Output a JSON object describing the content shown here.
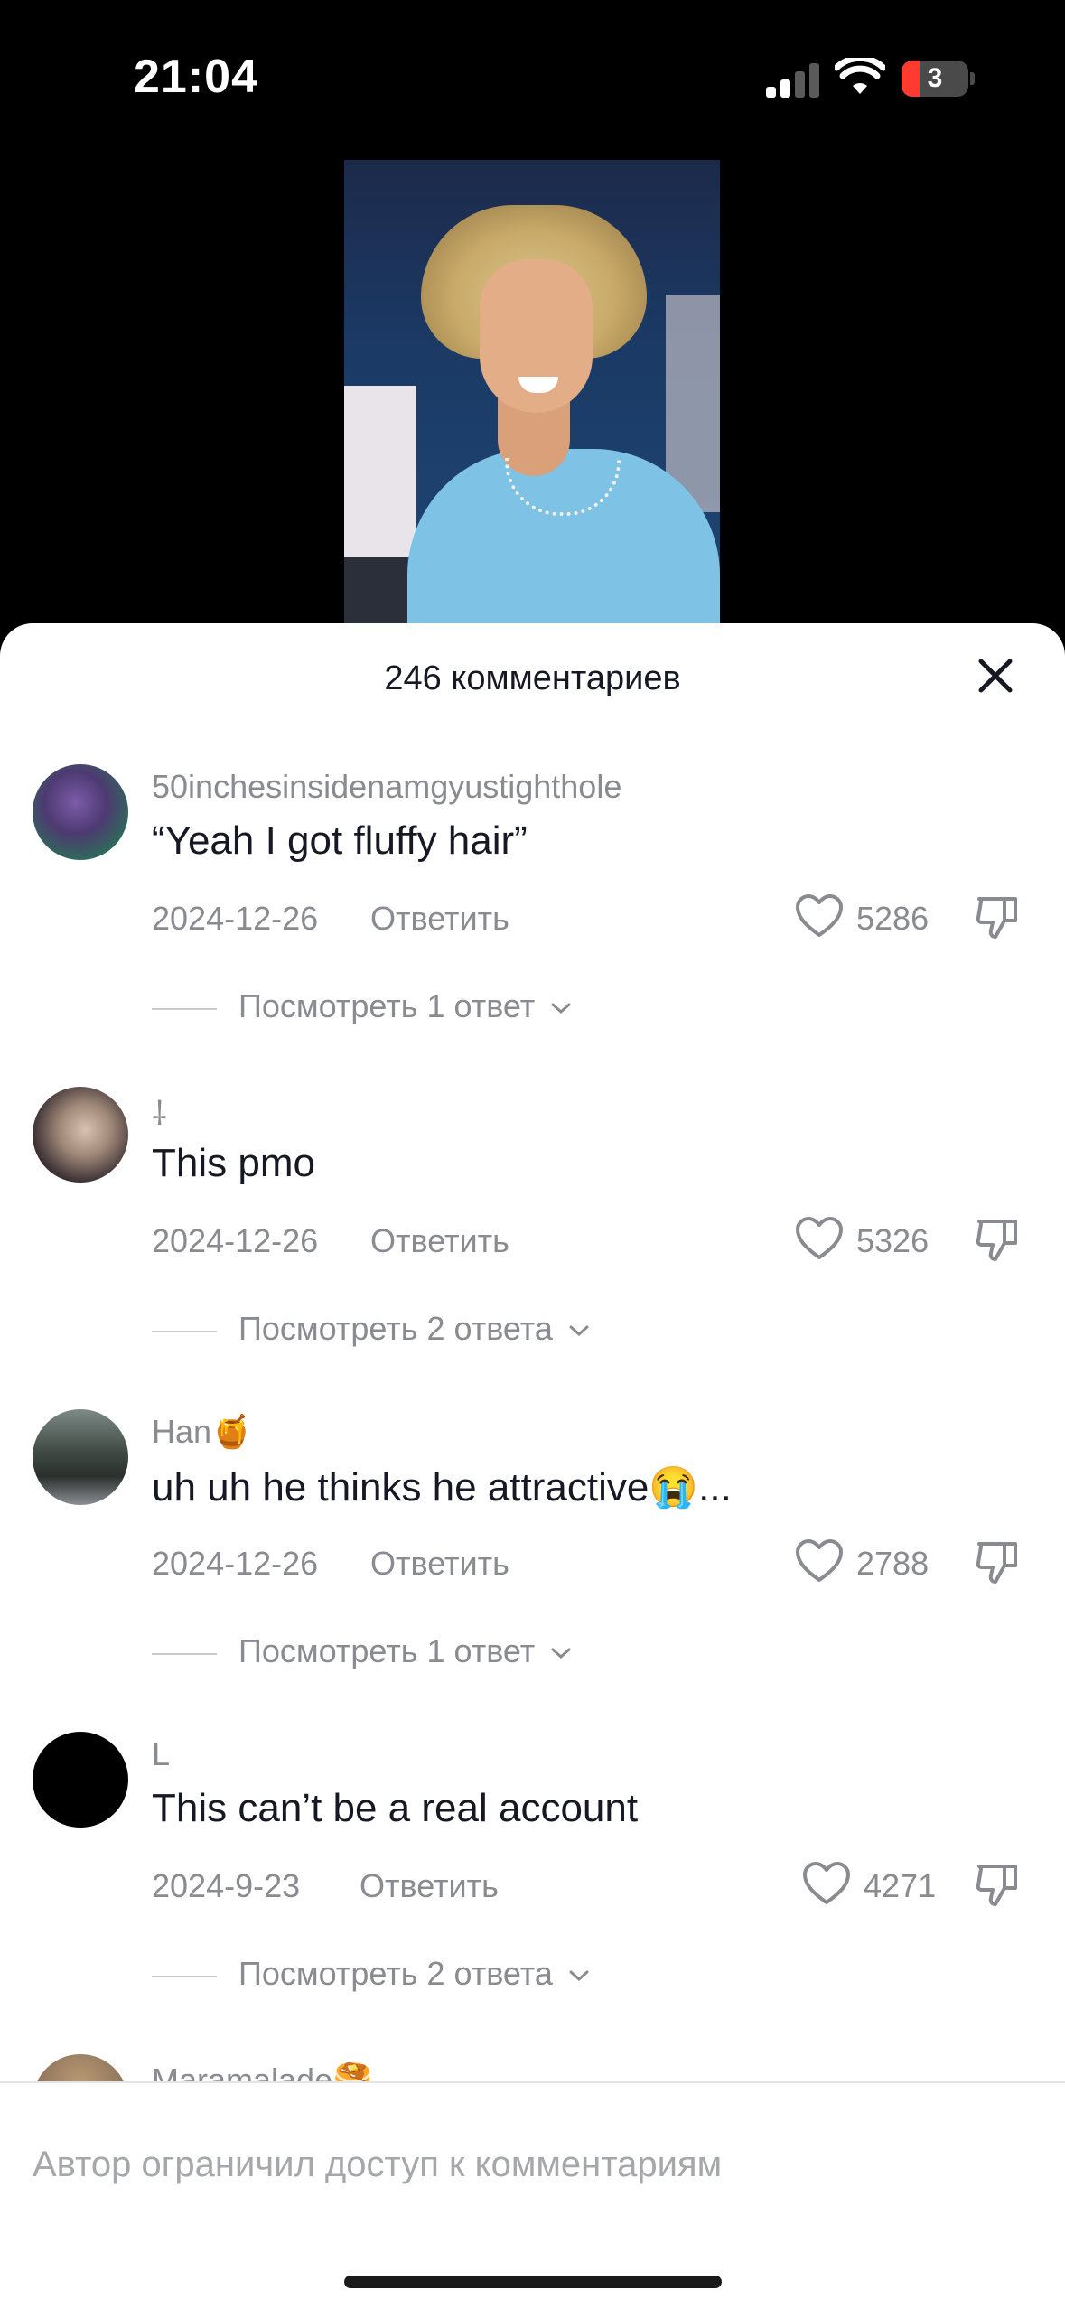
{
  "status_bar": {
    "time": "21:04",
    "battery_level": "3",
    "icons": [
      "cellular-signal-icon",
      "wifi-icon",
      "battery-icon"
    ]
  },
  "video": {
    "description_icon": "video-thumbnail"
  },
  "comments_sheet": {
    "title": "246 комментариев",
    "close_icon": "close-icon",
    "comments": [
      {
        "username": "50inchesinsidenamgyustighthole",
        "text": "“Yeah I got fluffy hair”",
        "date": "2024-12-26",
        "reply_label": "Ответить",
        "likes": "5286",
        "view_replies": "Посмотреть 1 ответ"
      },
      {
        "username": "⸸",
        "text": "This pmo",
        "date": "2024-12-26",
        "reply_label": "Ответить",
        "likes": "5326",
        "view_replies": "Посмотреть 2 ответа"
      },
      {
        "username": "Han🍯",
        "text": "uh uh he thinks he attractive😭...",
        "date": "2024-12-26",
        "reply_label": "Ответить",
        "likes": "2788",
        "view_replies": "Посмотреть 1 ответ"
      },
      {
        "username": "L",
        "text": "This can’t be a real account",
        "date": "2024-9-23",
        "reply_label": "Ответить",
        "likes": "4271",
        "view_replies": "Посмотреть 2 ответа"
      },
      {
        "username": "Maramalade🥞"
      }
    ],
    "footer_text": "Автор ограничил доступ к комментариям"
  },
  "colors": {
    "text_primary": "#161823",
    "text_secondary": "#8a8b91",
    "battery_low": "#ff3b30"
  }
}
